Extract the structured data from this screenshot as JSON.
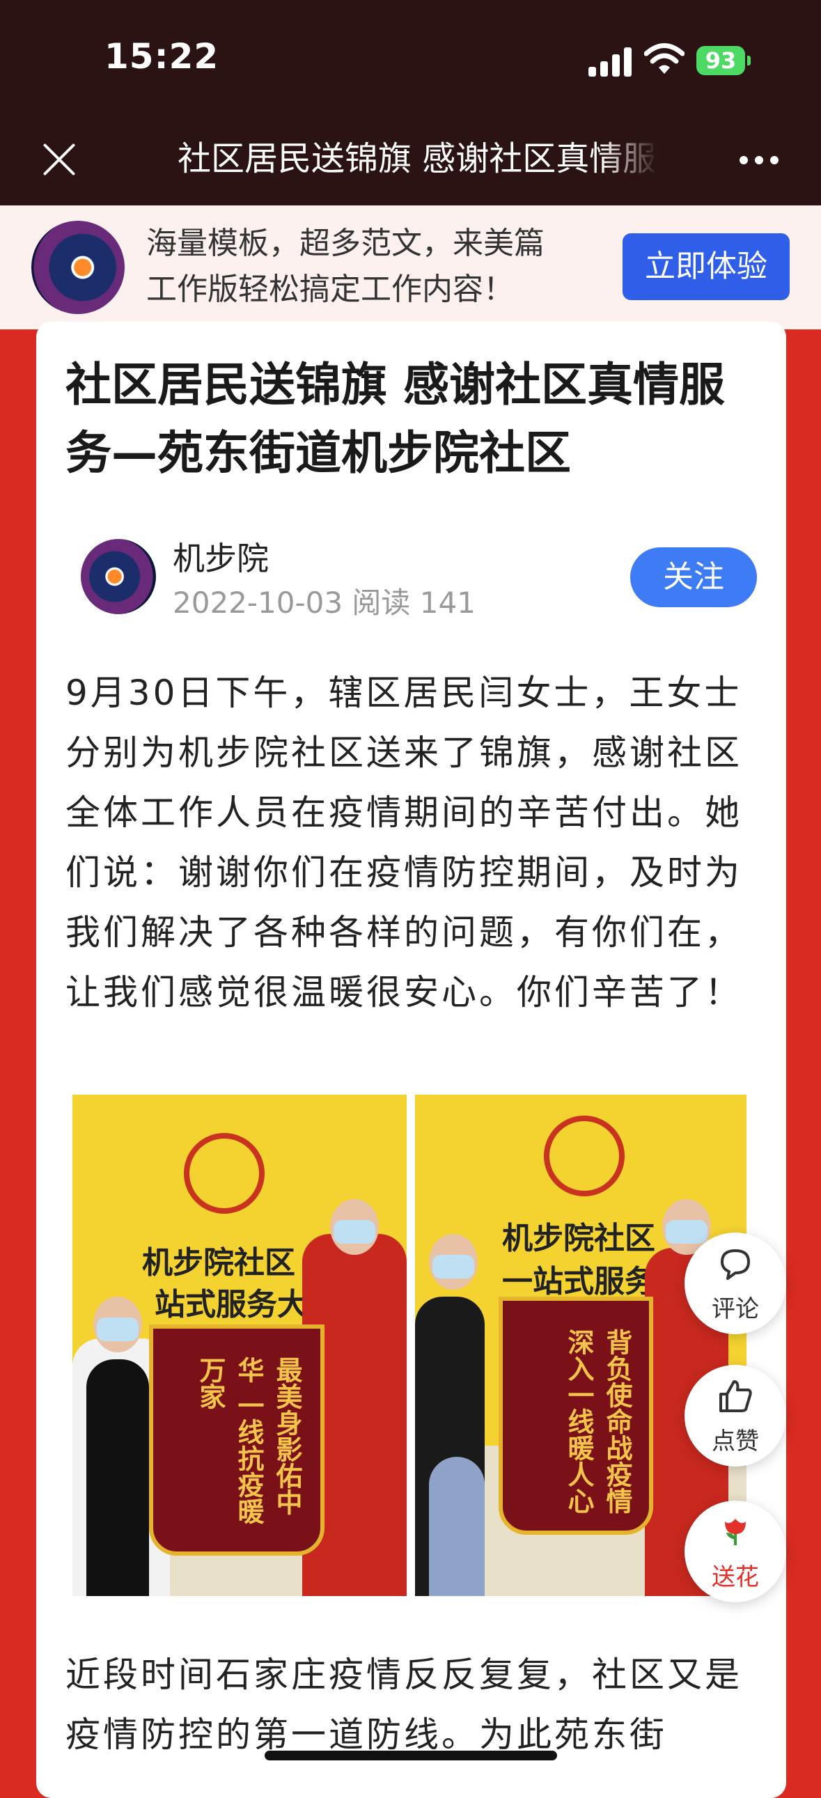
{
  "status": {
    "time": "15:22",
    "battery": "93"
  },
  "nav": {
    "title": "社区居民送锦旗 感谢社区真情服务—苑东街道机步院社区"
  },
  "promo": {
    "line1": "海量模板，超多范文，来美篇",
    "line2": "工作版轻松搞定工作内容！",
    "button": "立即体验"
  },
  "article": {
    "title": "社区居民送锦旗 感谢社区真情服务—苑东街道机步院社区",
    "author": "机步院",
    "meta": "2022-10-03 阅读 141",
    "follow": "关注",
    "para1": "9月30日下午，辖区居民闫女士，王女士分别为机步院社区送来了锦旗，感谢社区全体工作人员在疫情期间的辛苦付出。她们说：谢谢你们在疫情防控期间，及时为我们解决了各种各样的问题，有你们在，让我们感觉很温暖很安心。你们辛苦了！",
    "para2": "近段时间石家庄疫情反反复复，社区又是疫情防控的第一道防线。为此苑东街"
  },
  "photos": {
    "left": {
      "sign_line1": "机步院社区",
      "sign_line2": "站式服务大",
      "banner_main": "最美身影佑中华 一线抗疫暖万家"
    },
    "right": {
      "sign_line1": "机步院社区",
      "sign_line2": "一站式服务",
      "banner_main": "背负使命战疫情 深入一线暖人心"
    }
  },
  "actions": {
    "comment": "评论",
    "like": "点赞",
    "flower": "送花"
  },
  "icons": [
    "close-icon",
    "more-icon",
    "signal-icon",
    "wifi-icon",
    "battery-icon",
    "comment-icon",
    "like-icon",
    "rose-icon"
  ]
}
